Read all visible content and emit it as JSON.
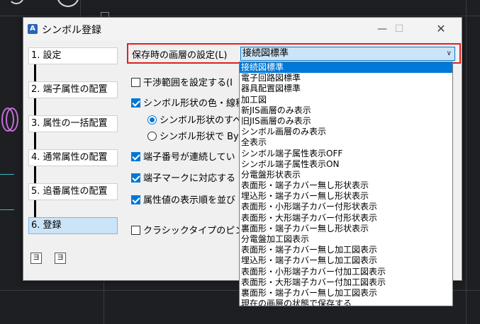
{
  "dialog": {
    "title": "シンボル登録",
    "app_icon_glyph": "A",
    "controls": {
      "minimize": "—",
      "maximize": "☐",
      "close": "✕"
    }
  },
  "steps": [
    {
      "label": "1. 設定",
      "active": false
    },
    {
      "label": "2. 端子属性の配置",
      "active": false
    },
    {
      "label": "3. 属性の一括配置",
      "active": false
    },
    {
      "label": "4. 通常属性の配置",
      "active": false
    },
    {
      "label": "5. 追番属性の配置",
      "active": false
    },
    {
      "label": "6. 登録",
      "active": true
    }
  ],
  "bottom_buttons": {
    "first": "ヨ",
    "second": "ヨ"
  },
  "layer_setting": {
    "label": "保存時の画層の設定(L)",
    "selected": "接続図標準"
  },
  "options": [
    {
      "type": "checkbox",
      "checked": false,
      "label": "干渉範囲を設定する(I"
    },
    {
      "type": "checkbox",
      "checked": true,
      "label": "シンボル形状の色・線種"
    },
    {
      "type": "radio",
      "checked": true,
      "label": "シンボル形状のすべ"
    },
    {
      "type": "radio",
      "checked": false,
      "label": "シンボル形状で  By"
    },
    {
      "type": "checkbox",
      "checked": true,
      "label": "端子番号が連続してい"
    },
    {
      "type": "checkbox",
      "checked": true,
      "label": "端子マークに対応する"
    },
    {
      "type": "checkbox",
      "checked": true,
      "label": "属性値の表示順を並び"
    },
    {
      "type": "checkbox",
      "checked": false,
      "label": "クラシックタイプのピンマ"
    }
  ],
  "dropdown_items": [
    "接続図標準",
    "電子回路図標準",
    "器具配置図標準",
    "加工図",
    "新JIS画層のみ表示",
    "旧JIS画層のみ表示",
    "シンボル画層のみ表示",
    "全表示",
    "シンボル端子属性表示OFF",
    "シンボル端子属性表示ON",
    "分電盤形状表示",
    "表面形・端子カバー無し形状表示",
    "埋込形・端子カバー無し形状表示",
    "表面形・小形端子カバー付形状表示",
    "表面形・大形端子カバー付形状表示",
    "裏面形・端子カバー無し形状表示",
    "分電盤加工図表示",
    "表面形・端子カバー無し加工図表示",
    "埋込形・端子カバー無し加工図表示",
    "表面形・小形端子カバー付加工図表示",
    "表面形・大形端子カバー付加工図表示",
    "裏面形・端子カバー無し加工図表示",
    "現在の画層の状態で保存する"
  ],
  "dropdown_selected_index": 0,
  "colors": {
    "accent": "#0078d7",
    "highlight_border": "#e02020",
    "background": "#1d1f23"
  }
}
